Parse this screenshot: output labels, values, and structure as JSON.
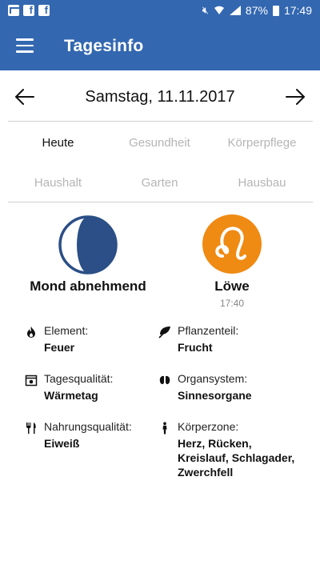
{
  "status_bar": {
    "battery": "87%",
    "time": "17:49",
    "icons": [
      "mail-icon",
      "facebook-icon",
      "facebook-icon",
      "mute-icon",
      "wifi-icon",
      "signal-icon",
      "battery-icon"
    ]
  },
  "app_bar": {
    "title": "Tagesinfo",
    "menu_icon": "hamburger-menu-icon",
    "color": "#3367b0"
  },
  "date_nav": {
    "date": "Samstag, 11.11.2017",
    "prev_icon": "arrow-left-icon",
    "next_icon": "arrow-right-icon"
  },
  "tabs": [
    {
      "label": "Heute",
      "active": true
    },
    {
      "label": "Gesundheit",
      "active": false
    },
    {
      "label": "Körperpflege",
      "active": false
    },
    {
      "label": "Haushalt",
      "active": false
    },
    {
      "label": "Garten",
      "active": false
    },
    {
      "label": "Hausbau",
      "active": false
    }
  ],
  "moon": {
    "label": "Mond abnehmend",
    "icon": "moon-waning-icon",
    "color": "#2b4f86"
  },
  "sign": {
    "label": "Löwe",
    "time": "17:40",
    "icon": "leo-zodiac-icon",
    "color": "#ef8a12"
  },
  "info": [
    {
      "icon": "fire-icon",
      "label": "Element:",
      "value": "Feuer"
    },
    {
      "icon": "leaf-icon",
      "label": "Pflanzenteil:",
      "value": "Frucht"
    },
    {
      "icon": "calendar-sun-icon",
      "label": "Tagesqualität:",
      "value": "Wärmetag"
    },
    {
      "icon": "organs-icon",
      "label": "Organsystem:",
      "value": "Sinnesorgane"
    },
    {
      "icon": "cutlery-icon",
      "label": "Nahrungsqualität:",
      "value": "Eiweiß"
    },
    {
      "icon": "human-body-icon",
      "label": "Körperzone:",
      "value_lines": [
        "Herz, Rücken,",
        "Kreislauf, Schlagader,",
        "Zwerchfell"
      ]
    }
  ]
}
